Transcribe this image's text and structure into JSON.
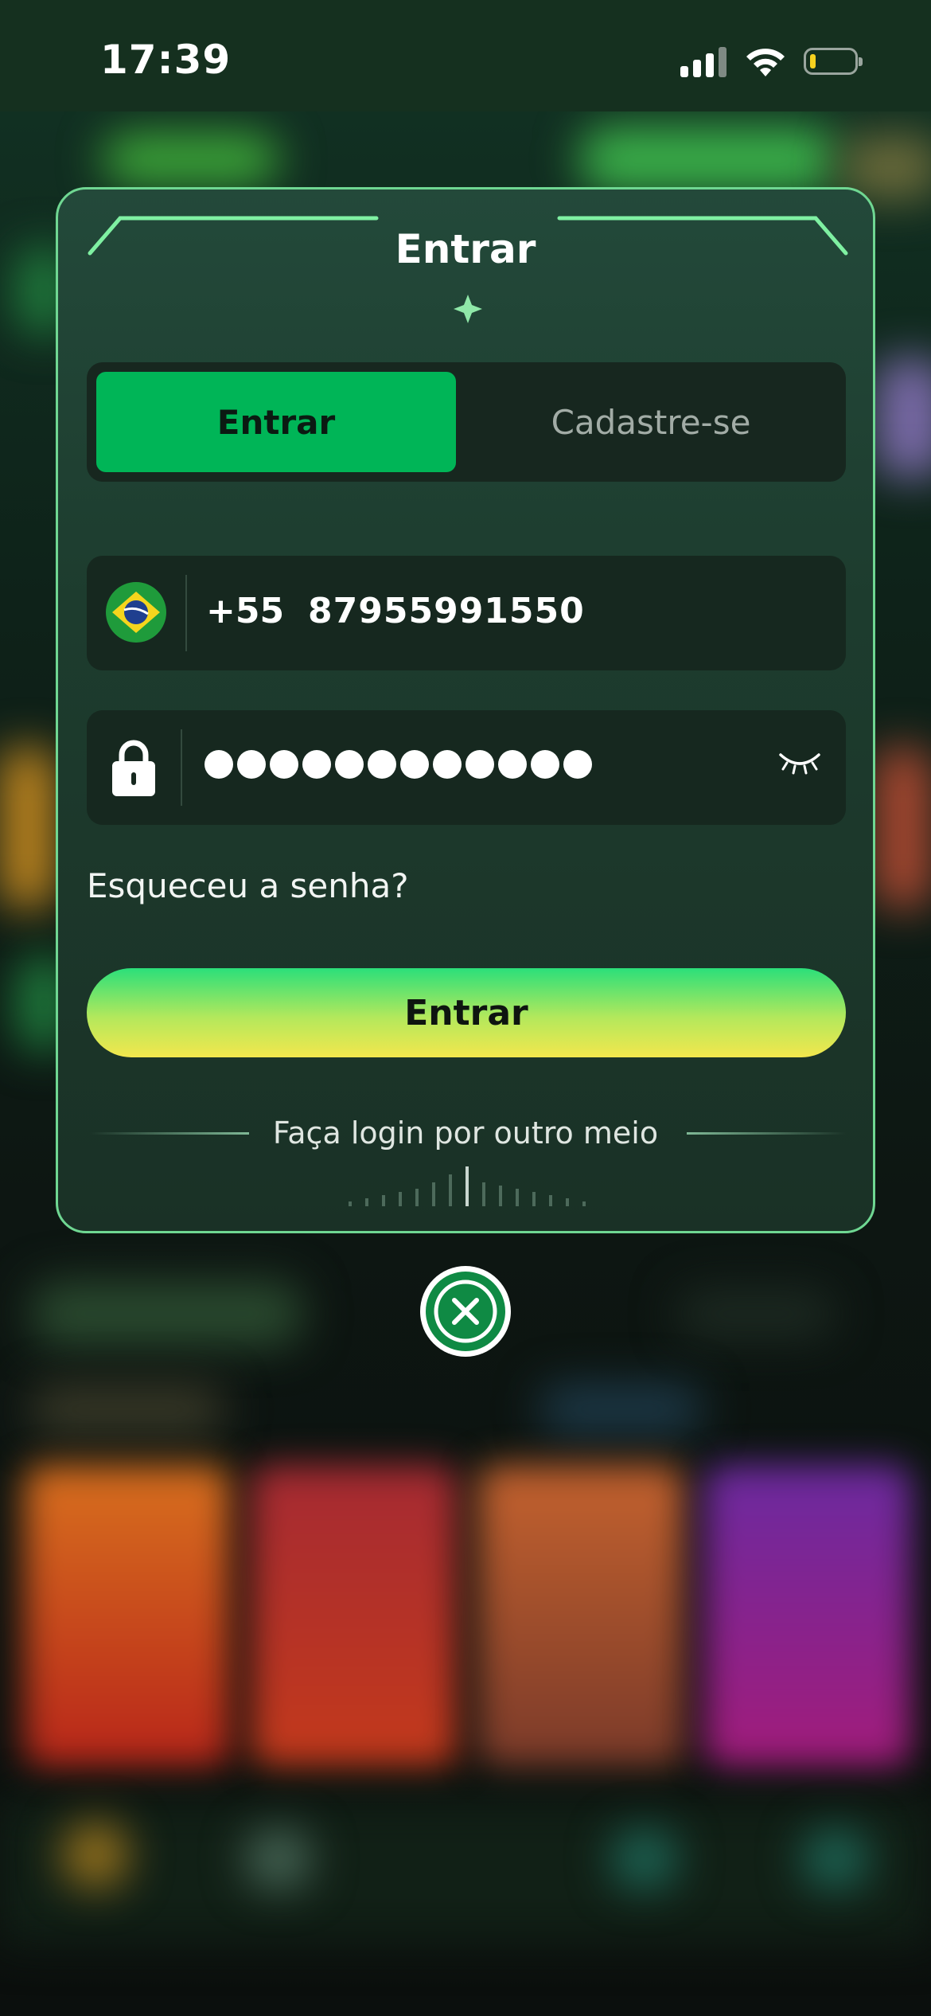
{
  "status_bar": {
    "time": "17:39"
  },
  "modal": {
    "title": "Entrar",
    "tabs": [
      {
        "label": "Entrar",
        "active": true
      },
      {
        "label": "Cadastre-se",
        "active": false
      }
    ],
    "phone": {
      "country_code": "+55",
      "number": "87955991550",
      "flag_icon": "brazil-flag-icon"
    },
    "password": {
      "masked_length": 12,
      "lock_icon": "lock-icon",
      "toggle_icon": "eye-closed-icon"
    },
    "forgot_link": "Esqueceu a senha?",
    "submit_label": "Entrar",
    "alt_login_label": "Faça login por outro meio",
    "close_icon": "close-icon"
  },
  "colors": {
    "accent_green": "#00b557",
    "modal_border": "#6fd792",
    "button_gradient_top": "#2bdf7a",
    "button_gradient_bottom": "#f3e74d"
  }
}
